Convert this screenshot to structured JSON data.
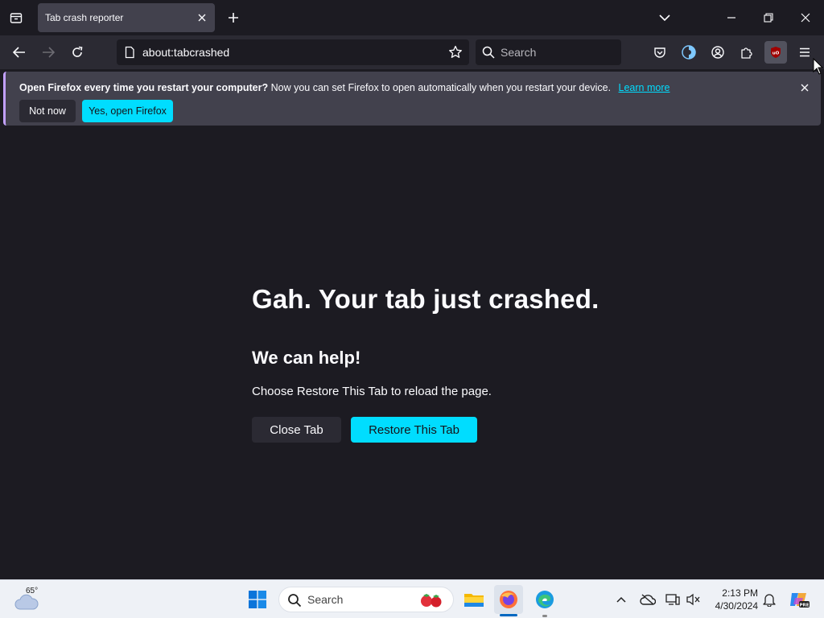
{
  "browser": {
    "tab": {
      "title": "Tab crash reporter"
    },
    "url": "about:tabcrashed",
    "search_placeholder": "Search"
  },
  "notification": {
    "bold_text": "Open Firefox every time you restart your computer?",
    "text": "Now you can set Firefox to open automatically when you restart your device.",
    "link": "Learn more",
    "not_now_label": "Not now",
    "yes_label": "Yes, open Firefox"
  },
  "page": {
    "title": "Gah. Your tab just crashed.",
    "subtitle": "We can help!",
    "description": "Choose Restore This Tab to reload the page.",
    "close_tab_label": "Close Tab",
    "restore_label": "Restore This Tab"
  },
  "taskbar": {
    "weather_temp": "65°",
    "search_placeholder": "Search",
    "time": "2:13 PM",
    "date": "4/30/2024"
  },
  "colors": {
    "accent": "#00ddff",
    "background": "#1c1b22",
    "toolbar": "#2b2a33",
    "notification_bg": "#42414d"
  }
}
